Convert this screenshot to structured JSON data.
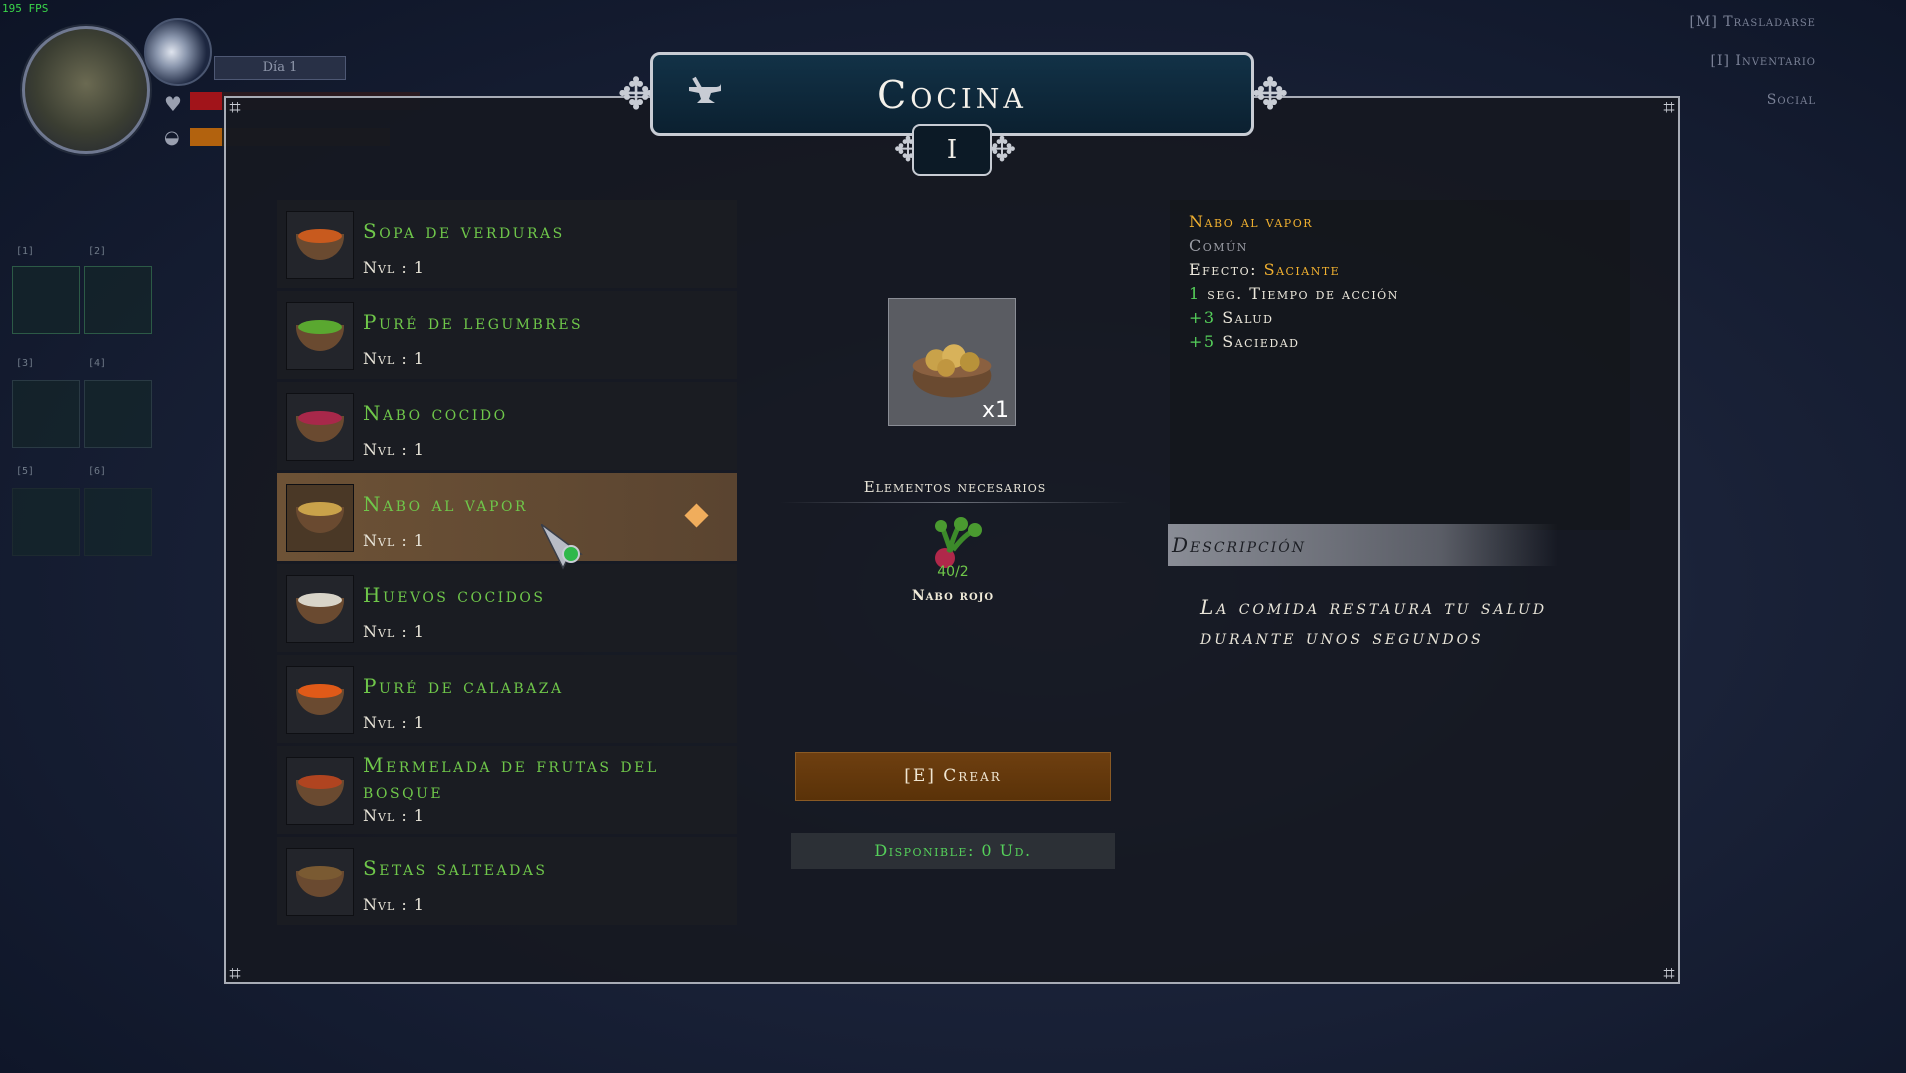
{
  "fps": "195 FPS",
  "hud": {
    "day_label": "Día 1",
    "top_menu": [
      {
        "key": "[M]",
        "label": "Trasladarse"
      },
      {
        "key": "[I]",
        "label": "Inventario"
      },
      {
        "key": "",
        "label": "Social"
      }
    ],
    "slot_keys": [
      "[1]",
      "[2]",
      "[3]",
      "[4]",
      "[5]",
      "[6]"
    ]
  },
  "window": {
    "title": "Cocina",
    "level": "I"
  },
  "recipes": [
    {
      "name": "Sopa de verduras",
      "level": "Nvl : 1",
      "food_color": "#c85a1e"
    },
    {
      "name": "Puré de legumbres",
      "level": "Nvl : 1",
      "food_color": "#5aa830"
    },
    {
      "name": "Nabo cocido",
      "level": "Nvl : 1",
      "food_color": "#a8284a"
    },
    {
      "name": "Nabo al vapor",
      "level": "Nvl : 1",
      "food_color": "#c9a24a",
      "selected": true
    },
    {
      "name": "Huevos cocidos",
      "level": "Nvl : 1",
      "food_color": "#d8d4c8"
    },
    {
      "name": "Puré de calabaza",
      "level": "Nvl : 1",
      "food_color": "#e05a18"
    },
    {
      "name": "Mermelada de frutas del bosque",
      "level": "Nvl : 1",
      "food_color": "#b04420"
    },
    {
      "name": "Setas salteadas",
      "level": "Nvl : 1",
      "food_color": "#7a5a32"
    }
  ],
  "result": {
    "quantity": "x1"
  },
  "requirements": {
    "label": "Elementos necesarios",
    "ingredient": {
      "name": "Nabo rojo",
      "count": "40/2"
    }
  },
  "craft_button": "[E] Crear",
  "available": "Disponible: 0 Ud.",
  "details": {
    "name": "Nabo al vapor",
    "rarity": "Común",
    "effect_label": "Efecto:",
    "effect_value": "Saciante",
    "action_time_value": "1",
    "action_time_label": "seg. Tiempo de acción",
    "health_value": "+3",
    "health_label": "Salud",
    "satiety_value": "+5",
    "satiety_label": "Saciedad"
  },
  "description": {
    "heading": "Descripción",
    "text": "La comida restaura tu salud durante unos segundos"
  },
  "colors": {
    "accent_green": "#6fc74a",
    "gold": "#f0b030",
    "craft_button": "#6e3f10"
  }
}
